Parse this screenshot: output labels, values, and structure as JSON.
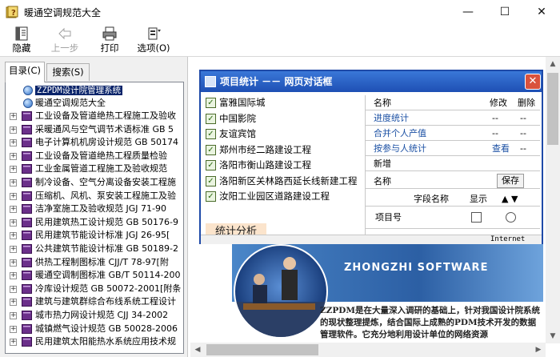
{
  "window": {
    "title": "暖通空调规范大全",
    "minimize": "—",
    "maximize": "☐",
    "close": "✕"
  },
  "toolbar": {
    "hide": "隐藏",
    "back": "上一步",
    "print": "打印",
    "options": "选项(O)"
  },
  "tabs": {
    "contents": "目录(C)",
    "search": "搜索(S)"
  },
  "tree": {
    "root1": "ZZPDM设计院管理系统",
    "root2": "暖通空调规范大全",
    "items": [
      "工业设备及管道绝热工程施工及验收",
      "采暖通风与空气调节术语标准 GB 5",
      "电子计算机机房设计规范 GB 50174",
      "工业设备及管道绝热工程质量检验",
      "工业金属管道工程施工及验收规范",
      "制冷设备、空气分离设备安装工程施",
      "压缩机、风机、泵安装工程施工及验",
      "洁净室施工及验收规范 JGJ 71-90",
      "民用建筑热工设计规范 GB 50176-9",
      "民用建筑节能设计标准 JGJ 26-95[",
      "公共建筑节能设计标准 GB 50189-2",
      "供热工程制图标准 CJJ/T 78-97[附",
      "暖通空调制图标准 GB/T 50114-200",
      "冷库设计规范 GB 50072-2001[附条",
      "建筑与建筑群综合布线系统工程设计",
      "城市热力网设计规范 CJJ 34-2002",
      "城镇燃气设计规范 GB 50028-2006",
      "民用建筑太阳能热水系统应用技术规"
    ]
  },
  "dialog": {
    "title": "项目统计 －－ 网页对话框",
    "checklist": [
      "富雅国际城",
      "中国影院",
      "友谊宾馆",
      "郑州市经二路建设工程",
      "洛阳市衡山路建设工程",
      "洛阳新区关林路西延长线新建工程",
      "汝阳工业园区道路建设工程"
    ],
    "stats_label": "统计分析",
    "table": {
      "headers": [
        "名称",
        "修改",
        "删除"
      ],
      "rows": [
        {
          "name": "进度统计",
          "edit": "--",
          "del": "--"
        },
        {
          "name": "合并个人产值",
          "edit": "--",
          "del": "--"
        },
        {
          "name": "按参与人统计",
          "edit": "查看",
          "del": "--"
        }
      ],
      "add_new": "新增",
      "name_label": "名称",
      "save_btn": "保存",
      "field_header": "字段名称",
      "display_header": "显示",
      "sort_header": "▲ ▼",
      "field_row": "项目号"
    },
    "statusbar": "Internet"
  },
  "hero": {
    "banner_text": "ZHONGZHI SOFTWARE",
    "desc": "ZZPDM是在大量深入调研的基础上，针对我国设计院系统的现状整理提炼，结合国际上成熟的PDM技术开发的数据管理软件。它充分地利用设计单位的网络资源"
  },
  "colors": {
    "accent": "#1f4aa8",
    "link": "#1a4fa3",
    "selected": "#0a246a"
  }
}
